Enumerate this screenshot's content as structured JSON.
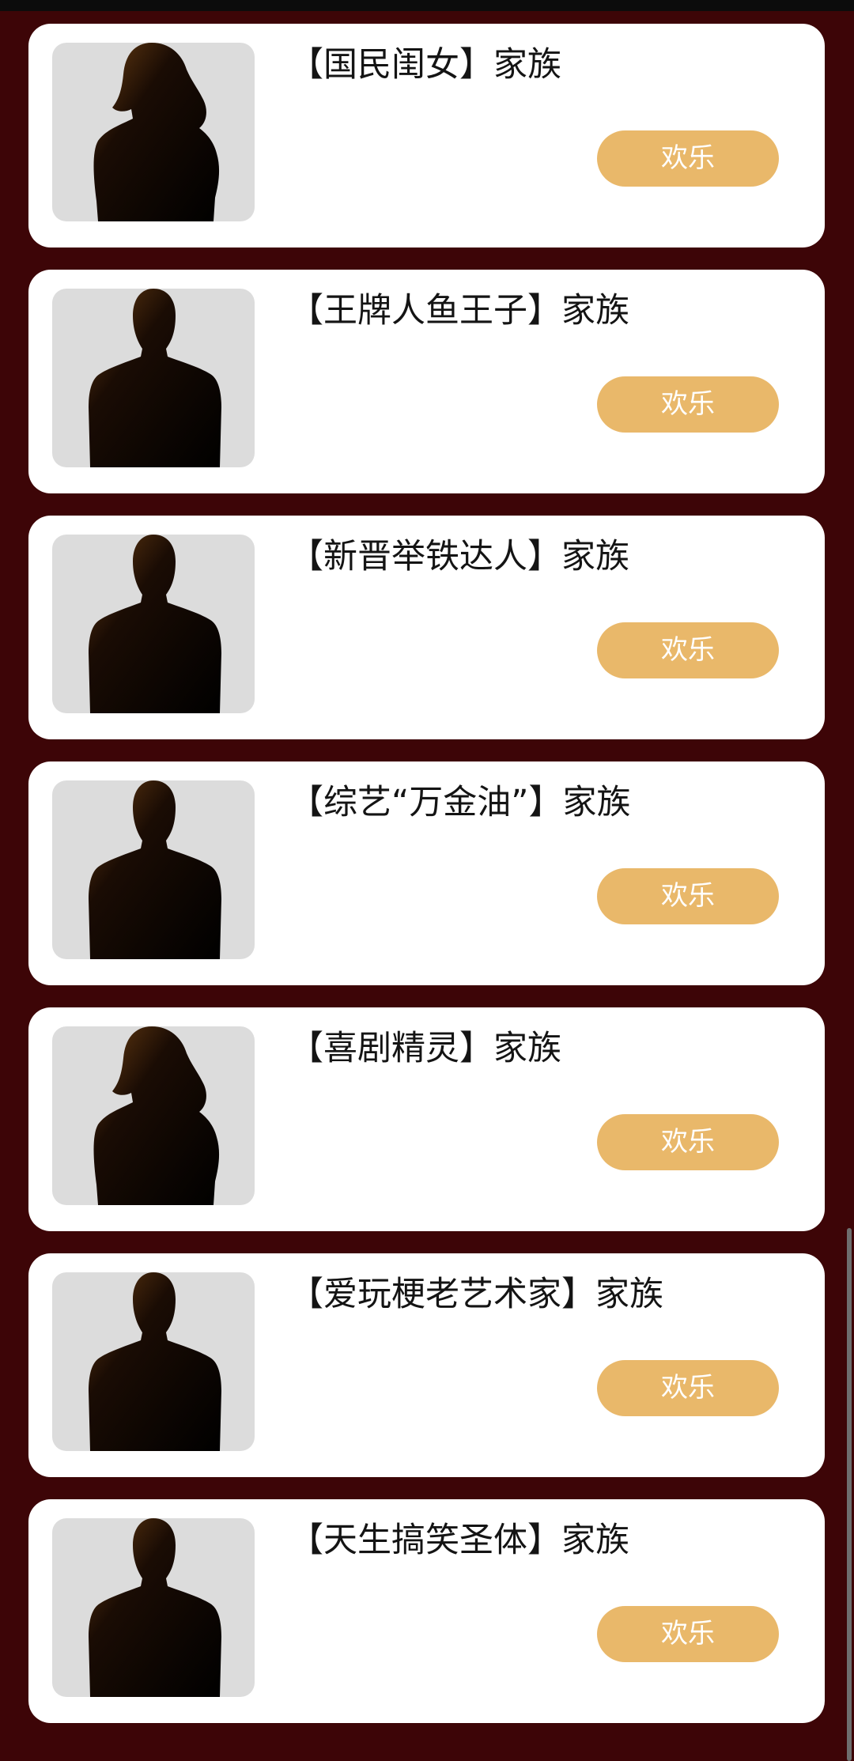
{
  "families": [
    {
      "title": "【国民闺女】家族",
      "button": "欢乐",
      "avatar": "female-silhouette-icon"
    },
    {
      "title": "【王牌人鱼王子】家族",
      "button": "欢乐",
      "avatar": "male-silhouette-icon"
    },
    {
      "title": "【新晋举铁达人】家族",
      "button": "欢乐",
      "avatar": "male-silhouette-icon"
    },
    {
      "title": "【综艺“万金油”】家族",
      "button": "欢乐",
      "avatar": "male-silhouette-icon"
    },
    {
      "title": "【喜剧精灵】家族",
      "button": "欢乐",
      "avatar": "female-silhouette-icon"
    },
    {
      "title": "【爱玩梗老艺术家】家族",
      "button": "欢乐",
      "avatar": "male-silhouette-icon"
    },
    {
      "title": "【天生搞笑圣体】家族",
      "button": "欢乐",
      "avatar": "male-silhouette-icon"
    }
  ],
  "colors": {
    "background": "#3d0507",
    "card": "#ffffff",
    "button": "#e9b86a",
    "avatar_bg": "#dcdcdc"
  }
}
